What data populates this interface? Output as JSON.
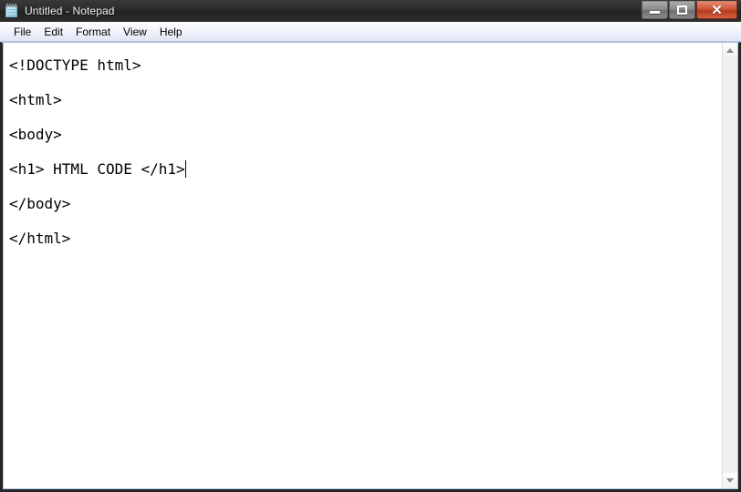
{
  "window": {
    "title": "Untitled - Notepad",
    "icon": "notepad-icon",
    "controls": {
      "minimize_label": "–",
      "maximize_label": "□",
      "close_label": "✕"
    }
  },
  "menubar": {
    "items": [
      {
        "label": "File"
      },
      {
        "label": "Edit"
      },
      {
        "label": "Format"
      },
      {
        "label": "View"
      },
      {
        "label": "Help"
      }
    ]
  },
  "editor": {
    "lines": [
      "<!DOCTYPE html>",
      "<html>",
      "<body>",
      "<h1> HTML CODE </h1>",
      "</body>",
      "</html>"
    ],
    "caret_line_index": 3
  },
  "scrollbar": {
    "up_arrow": "scroll-up-icon",
    "down_arrow": "scroll-down-icon"
  },
  "colors": {
    "titlebar": "#262626",
    "menubar": "#eef1f9",
    "close_button": "#cf5436",
    "text": "#000000",
    "background": "#ffffff"
  }
}
